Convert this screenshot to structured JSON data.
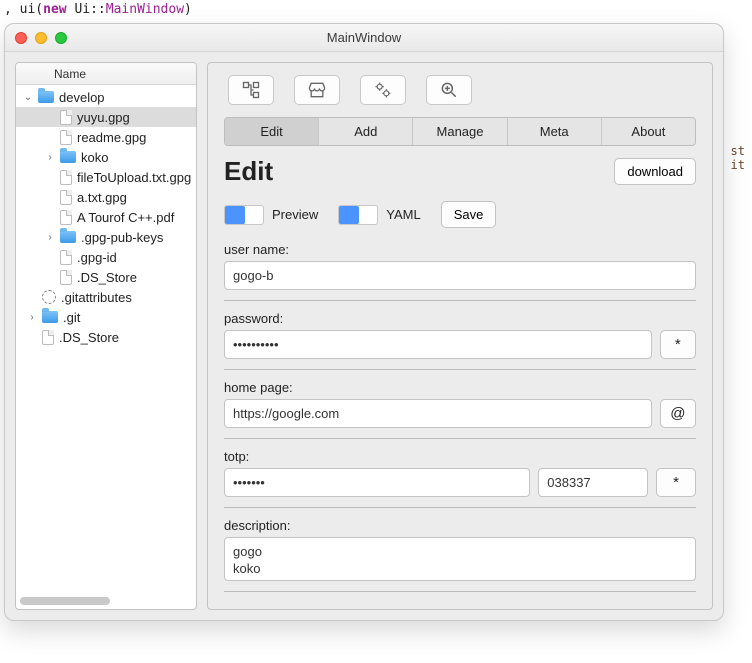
{
  "code_snippet": {
    "prefix": ", ui(",
    "keyword": "new",
    "ns": "Ui",
    "sep": "::",
    "cls": "MainWindow",
    "suffix": ")"
  },
  "window": {
    "title": "MainWindow"
  },
  "sidebar": {
    "header": "Name",
    "tree": {
      "root": {
        "name": "develop",
        "expanded": true
      },
      "children": [
        {
          "name": "yuyu.gpg",
          "type": "file",
          "selected": true
        },
        {
          "name": "readme.gpg",
          "type": "file"
        },
        {
          "name": "koko",
          "type": "folder",
          "expandable": true
        },
        {
          "name": "fileToUpload.txt.gpg",
          "type": "file"
        },
        {
          "name": "a.txt.gpg",
          "type": "file"
        },
        {
          "name": "A Tourof C++.pdf",
          "type": "file"
        },
        {
          "name": ".gpg-pub-keys",
          "type": "folder",
          "expandable": true
        },
        {
          "name": ".gpg-id",
          "type": "file"
        },
        {
          "name": ".DS_Store",
          "type": "file"
        }
      ],
      "siblings": [
        {
          "name": ".gitattributes",
          "type": "gear"
        },
        {
          "name": ".git",
          "type": "folder",
          "expandable": true
        },
        {
          "name": ".DS_Store",
          "type": "file"
        }
      ]
    }
  },
  "toolbar_icons": {
    "tree": "tree-icon",
    "store": "store-icon",
    "gears": "gears-icon",
    "zoom": "zoom-icon"
  },
  "tabs": [
    "Edit",
    "Add",
    "Manage",
    "Meta",
    "About"
  ],
  "active_tab": "Edit",
  "heading": "Edit",
  "download_label": "download",
  "toggles": {
    "preview": "Preview",
    "yaml": "YAML"
  },
  "save_label": "Save",
  "fields": {
    "username_label": "user name:",
    "username_value": "gogo-b",
    "password_label": "password:",
    "password_value": "••••••••••",
    "password_btn": "*",
    "homepage_label": "home page:",
    "homepage_value": "https://google.com",
    "homepage_btn": "@",
    "totp_label": "totp:",
    "totp_secret": "•••••••",
    "totp_code": "038337",
    "totp_btn": "*",
    "description_label": "description:",
    "description_value": "gogo\nkoko"
  },
  "gutter": {
    "line1": "st",
    "line2": "it"
  }
}
